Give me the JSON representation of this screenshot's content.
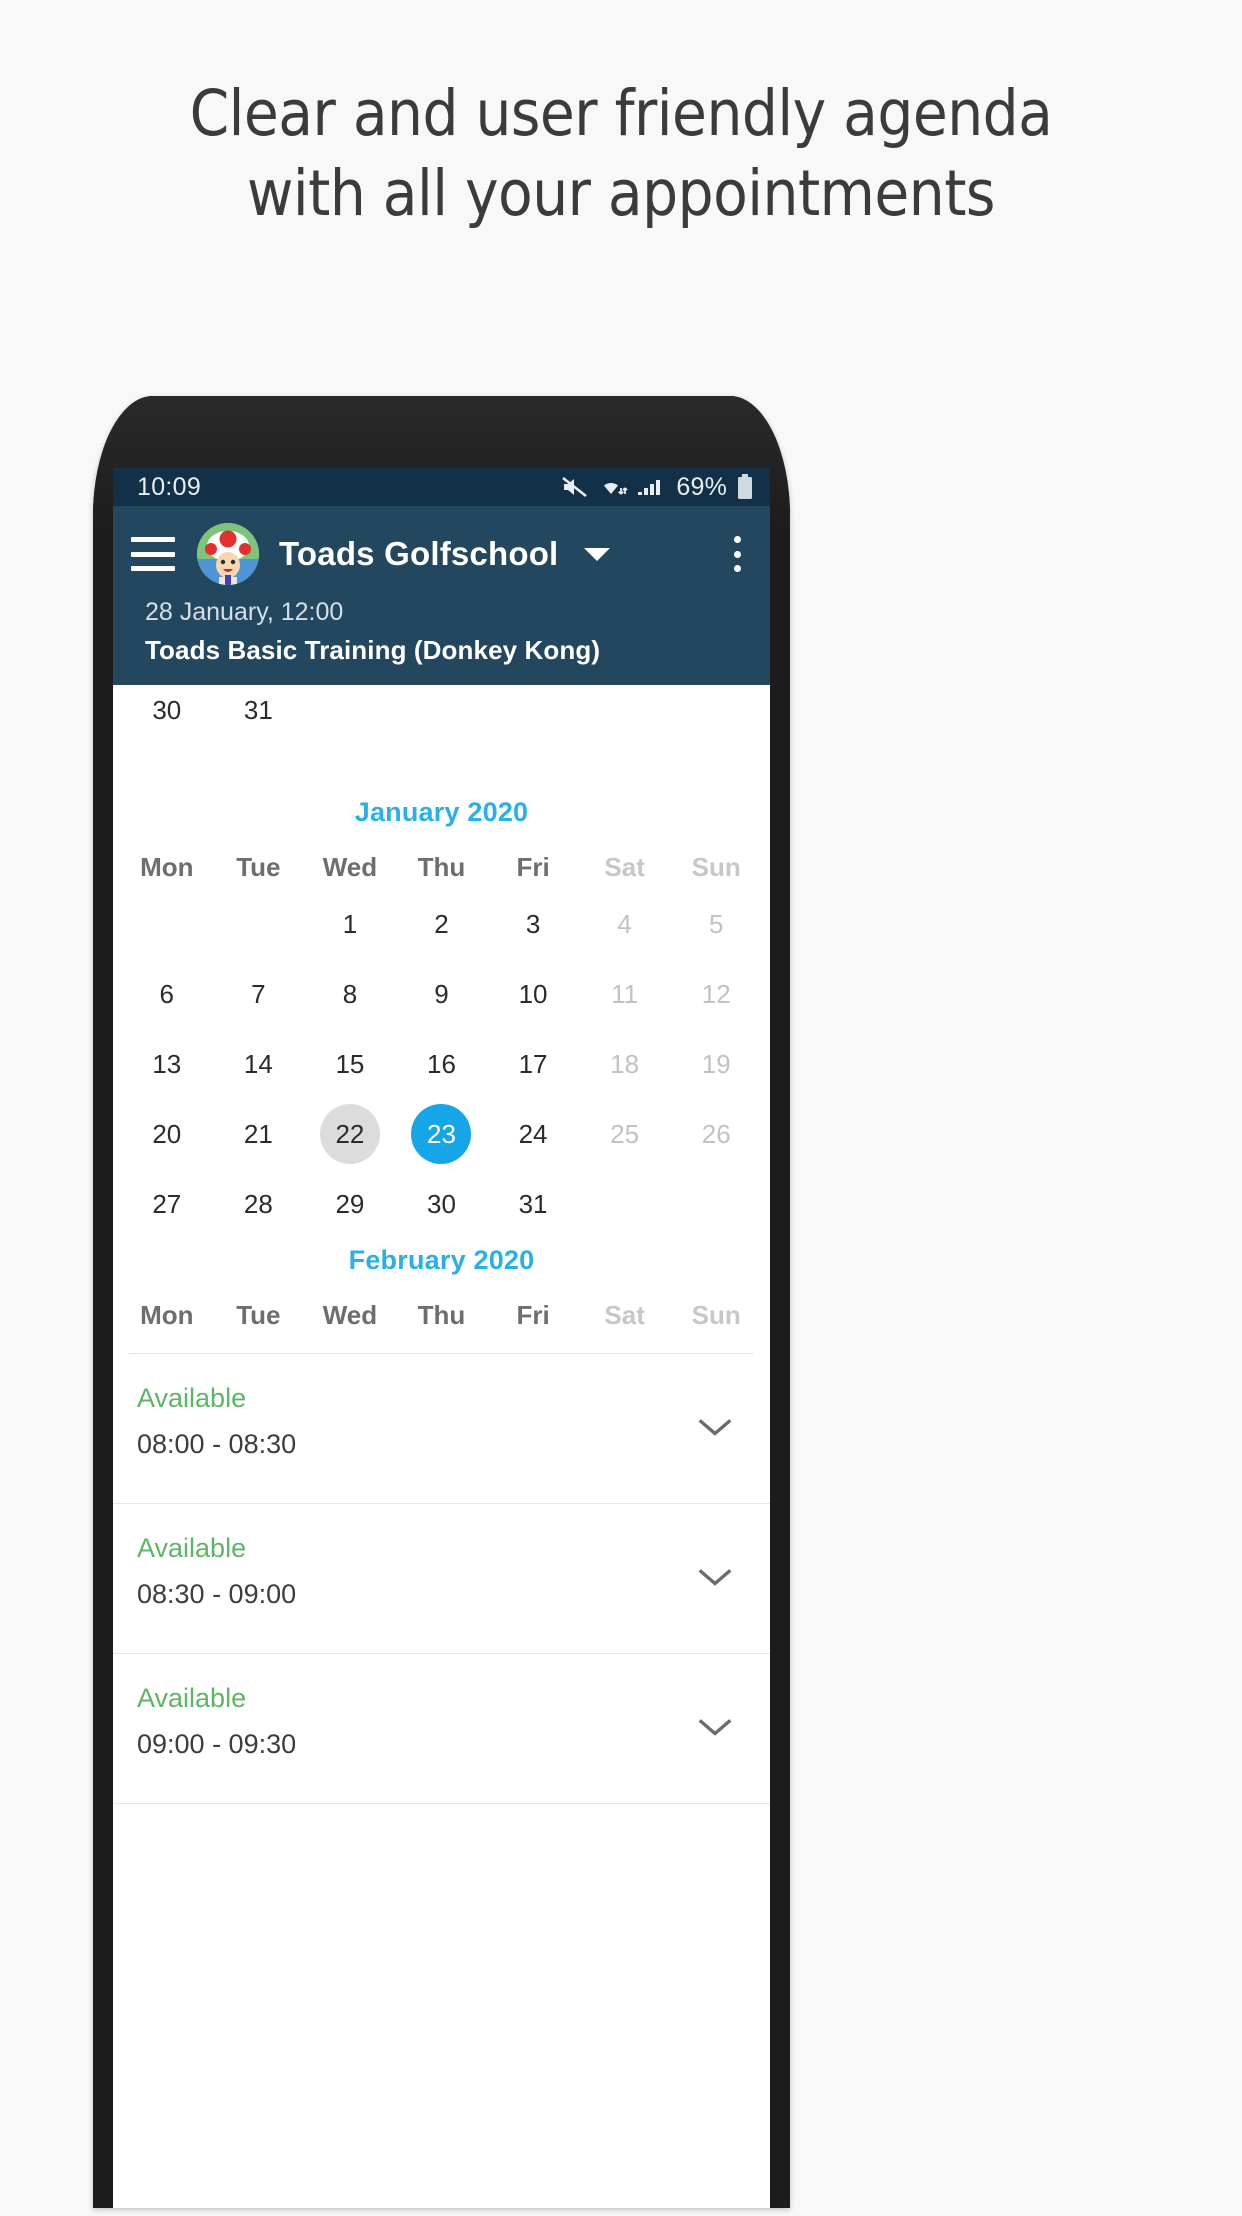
{
  "headline": {
    "line1": "Clear and user friendly agenda",
    "line2": "with all your appointments"
  },
  "colors": {
    "accent_blue": "#16a6e8",
    "month_label": "#29b0e8",
    "available_green": "#5fb566",
    "toolbar_bg": "#22475f",
    "statusbar_bg": "#123047",
    "today_gray": "#dcdcdc",
    "page_bg": "#f8f8f8"
  },
  "statusbar": {
    "clock": "10:09",
    "battery_percent": "69%",
    "icons": [
      "mute-icon",
      "wifi-icon",
      "signal-icon",
      "battery-icon"
    ]
  },
  "toolbar": {
    "menu_icon": "hamburger-menu-icon",
    "avatar": "toad-avatar",
    "title": "Toads Golfschool",
    "dropdown_icon": "chevron-down-icon",
    "overflow_icon": "more-vertical-icon",
    "subtitle_date": "28 January, 12:00",
    "subtitle_title": "Toads Basic Training (Donkey Kong)"
  },
  "calendar": {
    "weekdays": [
      "Mon",
      "Tue",
      "Wed",
      "Thu",
      "Fri",
      "Sat",
      "Sun"
    ],
    "weekend_indices": [
      5,
      6
    ],
    "previous_month_tail": [
      "30",
      "31"
    ],
    "months": [
      {
        "label": "January 2020",
        "leading_blanks": 2,
        "days": [
          {
            "n": "1"
          },
          {
            "n": "2"
          },
          {
            "n": "3"
          },
          {
            "n": "4",
            "weekend": true
          },
          {
            "n": "5",
            "weekend": true
          },
          {
            "n": "6"
          },
          {
            "n": "7"
          },
          {
            "n": "8"
          },
          {
            "n": "9"
          },
          {
            "n": "10"
          },
          {
            "n": "11",
            "weekend": true
          },
          {
            "n": "12",
            "weekend": true
          },
          {
            "n": "13"
          },
          {
            "n": "14"
          },
          {
            "n": "15"
          },
          {
            "n": "16"
          },
          {
            "n": "17"
          },
          {
            "n": "18",
            "weekend": true
          },
          {
            "n": "19",
            "weekend": true
          },
          {
            "n": "20"
          },
          {
            "n": "21"
          },
          {
            "n": "22",
            "today": true
          },
          {
            "n": "23",
            "selected": true
          },
          {
            "n": "24"
          },
          {
            "n": "25",
            "weekend": true
          },
          {
            "n": "26",
            "weekend": true
          },
          {
            "n": "27"
          },
          {
            "n": "28"
          },
          {
            "n": "29"
          },
          {
            "n": "30"
          },
          {
            "n": "31"
          }
        ]
      },
      {
        "label": "February 2020",
        "leading_blanks": 5,
        "days": []
      }
    ]
  },
  "slots": [
    {
      "status": "Available",
      "time": "08:00 - 08:30",
      "expand_icon": "chevron-down-icon"
    },
    {
      "status": "Available",
      "time": "08:30 - 09:00",
      "expand_icon": "chevron-down-icon"
    },
    {
      "status": "Available",
      "time": "09:00 - 09:30",
      "expand_icon": "chevron-down-icon"
    }
  ]
}
